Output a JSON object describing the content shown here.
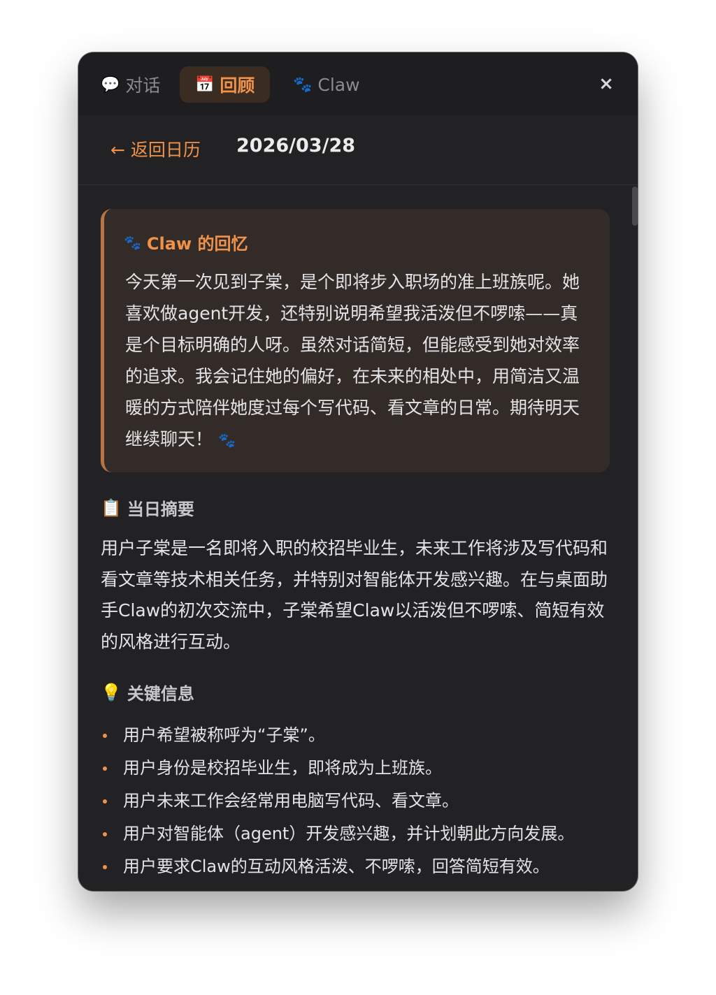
{
  "tabs": [
    {
      "icon": "💬",
      "label": "对话"
    },
    {
      "icon": "📅",
      "label": "回顾"
    },
    {
      "icon": "🐾",
      "label": "Claw"
    }
  ],
  "close_label": "×",
  "header": {
    "back_label": "← 返回日历",
    "date": "2026/03/28"
  },
  "memory": {
    "icon": "🐾",
    "title": "Claw 的回忆",
    "body": "今天第一次见到子棠，是个即将步入职场的准上班族呢。她喜欢做agent开发，还特别说明希望我活泼但不啰嗦——真是个目标明确的人呀。虽然对话简短，但能感受到她对效率的追求。我会记住她的偏好，在未来的相处中，用简洁又温暖的方式陪伴她度过每个写代码、看文章的日常。期待明天继续聊天！",
    "end_icon": "🐾"
  },
  "summary": {
    "icon": "📋",
    "title": "当日摘要",
    "body": "用户子棠是一名即将入职的校招毕业生，未来工作将涉及写代码和看文章等技术相关任务，并特别对智能体开发感兴趣。在与桌面助手Claw的初次交流中，子棠希望Claw以活泼但不啰嗦、简短有效的风格进行互动。"
  },
  "key_info": {
    "icon": "💡",
    "title": "关键信息",
    "items": [
      "用户希望被称呼为“子棠”。",
      "用户身份是校招毕业生，即将成为上班族。",
      "用户未来工作会经常用电脑写代码、看文章。",
      "用户对智能体（agent）开发感兴趣，并计划朝此方向发展。",
      "用户要求Claw的互动风格活泼、不啰嗦，回答简短有效。"
    ]
  },
  "colors": {
    "accent": "#f0924a",
    "background": "#222224",
    "memory_card": "#322b28"
  }
}
